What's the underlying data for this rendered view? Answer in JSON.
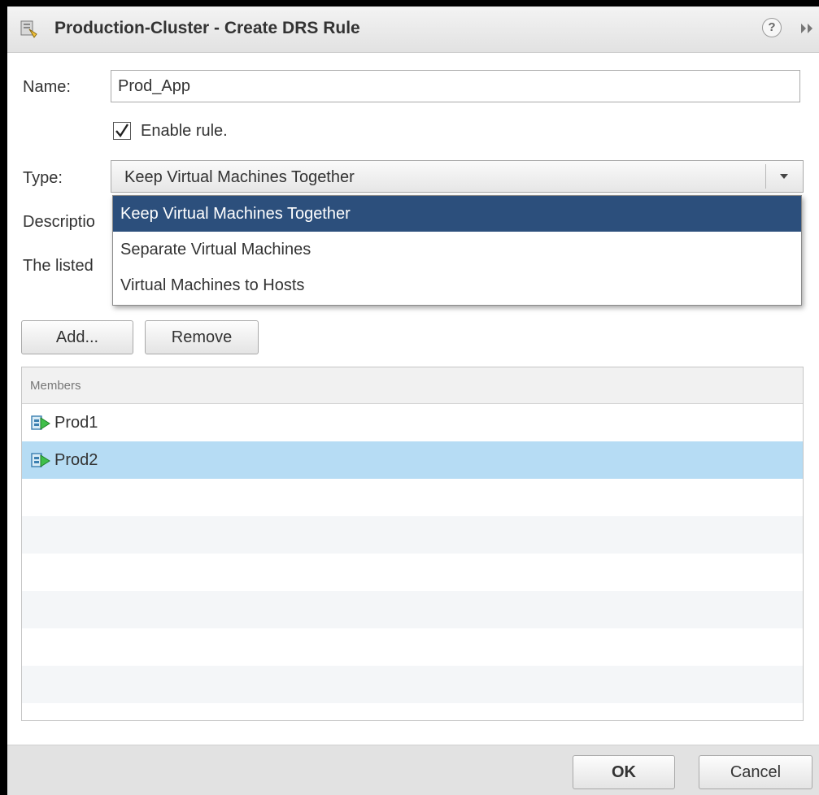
{
  "dialog": {
    "title": "Production-Cluster - Create DRS Rule",
    "help_glyph": "?"
  },
  "form": {
    "name_label": "Name:",
    "name_value": "Prod_App",
    "enable_label": "Enable rule.",
    "enable_checked": true,
    "type_label": "Type:",
    "type_selected": "Keep Virtual Machines Together",
    "description_label_visible": "Descriptio",
    "listed_text_visible": "The listed"
  },
  "type_options": [
    {
      "label": "Keep Virtual Machines Together",
      "selected": true
    },
    {
      "label": "Separate Virtual Machines",
      "selected": false
    },
    {
      "label": "Virtual Machines to Hosts",
      "selected": false
    }
  ],
  "buttons": {
    "add": "Add...",
    "remove": "Remove",
    "ok": "OK",
    "cancel": "Cancel"
  },
  "members": {
    "header": "Members",
    "rows": [
      {
        "name": "Prod1",
        "icon": "vm-icon",
        "selected": false
      },
      {
        "name": "Prod2",
        "icon": "vm-icon",
        "selected": true
      }
    ]
  },
  "colors": {
    "dropdown_selected": "#2c4f7c",
    "row_selected": "#b6dcf4"
  }
}
